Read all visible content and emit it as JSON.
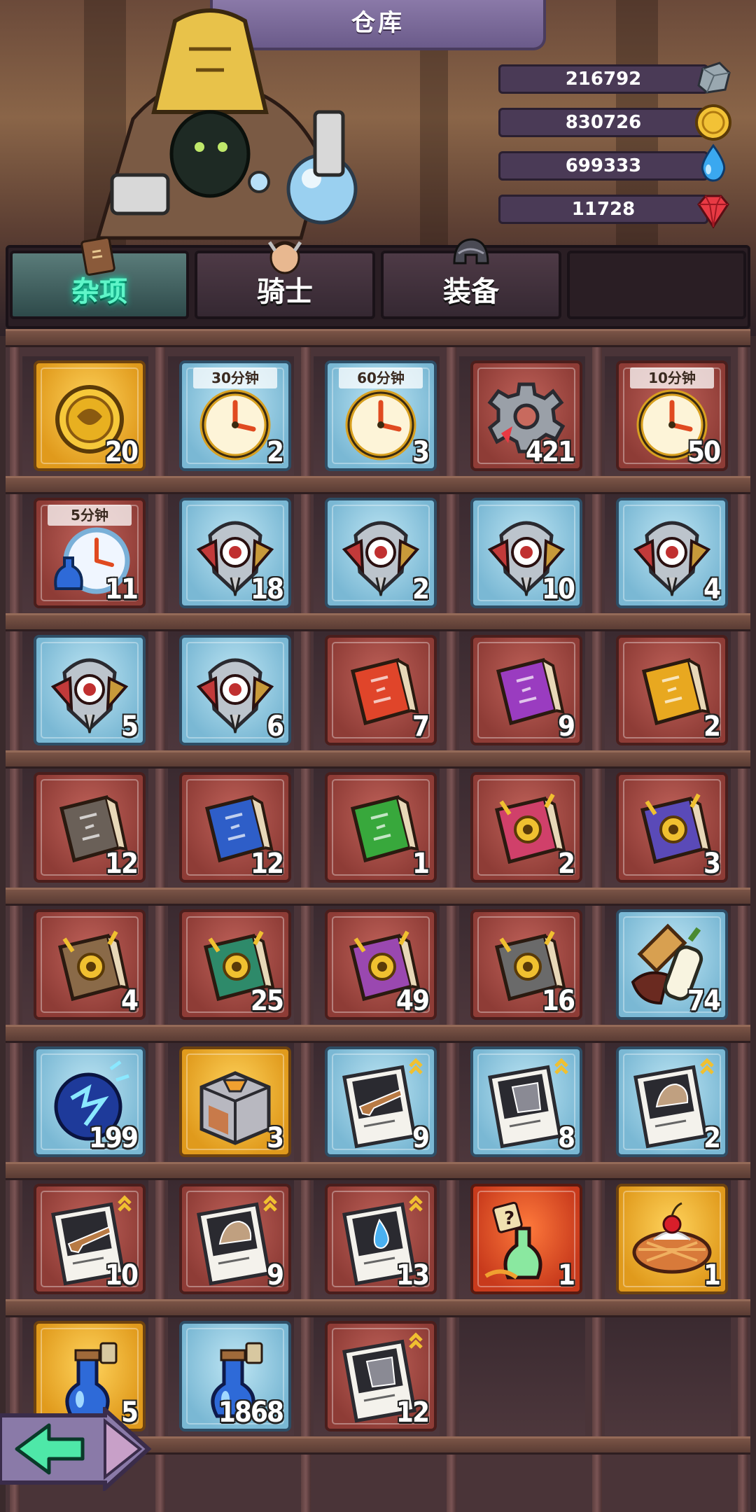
{
  "title": "仓库",
  "resources": [
    {
      "value": "216792",
      "icon": "stone-icon"
    },
    {
      "value": "830726",
      "icon": "gold-coin-icon"
    },
    {
      "value": "699333",
      "icon": "water-drop-icon"
    },
    {
      "value": "11728",
      "icon": "ruby-gem-icon"
    }
  ],
  "tabs": [
    {
      "label": "杂项",
      "active": true,
      "icon": "scroll-book-icon"
    },
    {
      "label": "骑士",
      "active": false,
      "icon": "knight-portrait-icon"
    },
    {
      "label": "装备",
      "active": false,
      "icon": "helmet-icon"
    }
  ],
  "items": [
    {
      "count": "20",
      "frame": "gold",
      "icon": "coin-icon"
    },
    {
      "count": "2",
      "frame": "blue",
      "icon": "clock-icon",
      "label": "30分钟"
    },
    {
      "count": "3",
      "frame": "blue",
      "icon": "clock-icon",
      "label": "60分钟"
    },
    {
      "count": "421",
      "frame": "red",
      "icon": "gear-icon"
    },
    {
      "count": "50",
      "frame": "red",
      "icon": "clock-icon",
      "label": "10分钟"
    },
    {
      "count": "11",
      "frame": "red",
      "icon": "clock-potion-icon",
      "label": "5分钟"
    },
    {
      "count": "18",
      "frame": "blue",
      "icon": "eye-emblem-icon"
    },
    {
      "count": "2",
      "frame": "blue",
      "icon": "eye-emblem-icon"
    },
    {
      "count": "10",
      "frame": "blue",
      "icon": "eye-emblem-icon"
    },
    {
      "count": "4",
      "frame": "blue",
      "icon": "eye-emblem-icon"
    },
    {
      "count": "5",
      "frame": "blue",
      "icon": "eye-emblem-icon"
    },
    {
      "count": "6",
      "frame": "blue",
      "icon": "eye-emblem-icon"
    },
    {
      "count": "7",
      "frame": "red",
      "icon": "book-icon",
      "color": "#e0452a"
    },
    {
      "count": "9",
      "frame": "red",
      "icon": "book-icon",
      "color": "#9a3cc0"
    },
    {
      "count": "2",
      "frame": "red",
      "icon": "book-icon",
      "color": "#e8a820"
    },
    {
      "count": "12",
      "frame": "red",
      "icon": "book-icon",
      "color": "#6a6058"
    },
    {
      "count": "12",
      "frame": "red",
      "icon": "book-icon",
      "color": "#2e5ec8"
    },
    {
      "count": "1",
      "frame": "red",
      "icon": "book-icon",
      "color": "#38a83c"
    },
    {
      "count": "2",
      "frame": "red",
      "icon": "gear-book-icon",
      "color": "#d0406a"
    },
    {
      "count": "3",
      "frame": "red",
      "icon": "gear-book-icon",
      "color": "#5a4ab8"
    },
    {
      "count": "4",
      "frame": "red",
      "icon": "gear-book-icon",
      "color": "#8a6a48"
    },
    {
      "count": "25",
      "frame": "red",
      "icon": "gear-book-icon",
      "color": "#2e8a6a"
    },
    {
      "count": "49",
      "frame": "red",
      "icon": "gear-book-icon",
      "color": "#9a48b0"
    },
    {
      "count": "16",
      "frame": "red",
      "icon": "gear-book-icon",
      "color": "#6a6a6a"
    },
    {
      "count": "74",
      "frame": "blue",
      "icon": "glue-plank-icon"
    },
    {
      "count": "199",
      "frame": "blue",
      "icon": "lightning-orb-icon"
    },
    {
      "count": "3",
      "frame": "gold",
      "icon": "crate-icon"
    },
    {
      "count": "9",
      "frame": "blue",
      "icon": "rifle-card-icon"
    },
    {
      "count": "8",
      "frame": "blue",
      "icon": "armor-card-icon"
    },
    {
      "count": "2",
      "frame": "blue",
      "icon": "helmet-card-icon"
    },
    {
      "count": "10",
      "frame": "red",
      "icon": "rifle-card-icon"
    },
    {
      "count": "9",
      "frame": "red",
      "icon": "helmet-card-icon"
    },
    {
      "count": "13",
      "frame": "red",
      "icon": "potion-card-icon"
    },
    {
      "count": "1",
      "frame": "orange",
      "icon": "mystery-potion-icon"
    },
    {
      "count": "1",
      "frame": "gold",
      "icon": "cherry-pie-icon"
    },
    {
      "count": "5",
      "frame": "gold",
      "icon": "potion-icon"
    },
    {
      "count": "1868",
      "frame": "blue",
      "icon": "potion-icon"
    },
    {
      "count": "12",
      "frame": "red",
      "icon": "armor-card-icon"
    }
  ],
  "back_button": {
    "icon": "back-arrow-icon"
  }
}
